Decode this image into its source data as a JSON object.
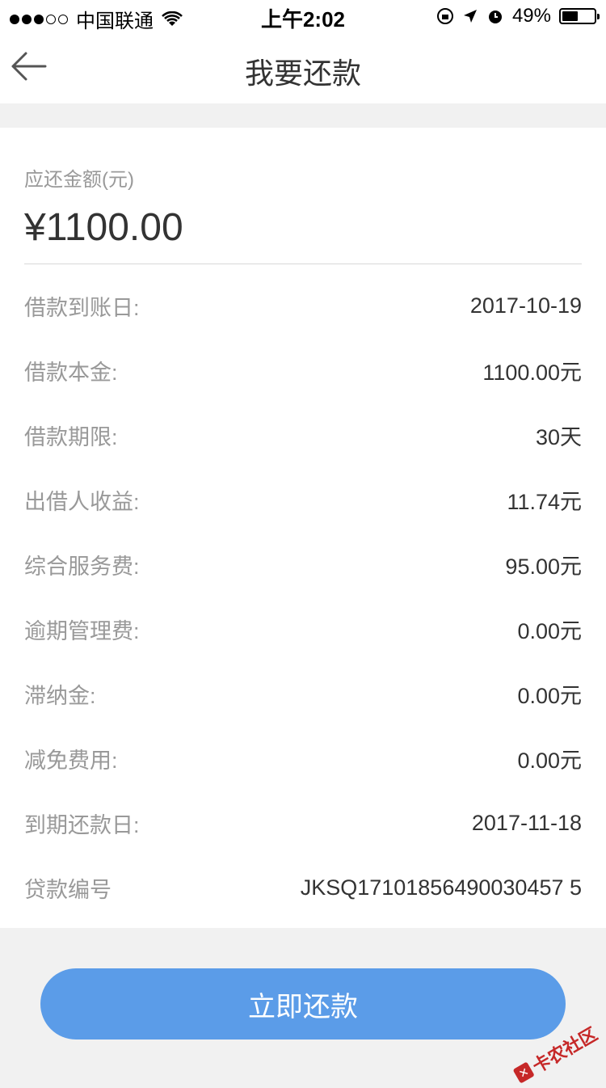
{
  "status_bar": {
    "carrier": "中国联通",
    "time": "上午2:02",
    "battery_text": "49%",
    "battery_level": 0.49
  },
  "nav": {
    "title": "我要还款",
    "back_icon": "arrow-left-icon"
  },
  "amount": {
    "label": "应还金额(元)",
    "value": "¥1100.00"
  },
  "details": [
    {
      "label": "借款到账日:",
      "value": "2017-10-19"
    },
    {
      "label": "借款本金:",
      "value": "1100.00元"
    },
    {
      "label": "借款期限:",
      "value": "30天"
    },
    {
      "label": "出借人收益:",
      "value": "11.74元"
    },
    {
      "label": "综合服务费:",
      "value": "95.00元"
    },
    {
      "label": "逾期管理费:",
      "value": "0.00元"
    },
    {
      "label": "滞纳金:",
      "value": "0.00元"
    },
    {
      "label": "减免费用:",
      "value": "0.00元"
    },
    {
      "label": "到期还款日:",
      "value": "2017-11-18"
    },
    {
      "label": "贷款编号",
      "value": "JKSQ17101856490030457 5"
    }
  ],
  "action": {
    "repay_label": "立即还款"
  },
  "watermark": {
    "text": "卡农社区"
  },
  "colors": {
    "primary_button": "#5b9ce8",
    "label_text": "#999999",
    "value_text": "#333333",
    "page_bg": "#f1f1f1"
  }
}
